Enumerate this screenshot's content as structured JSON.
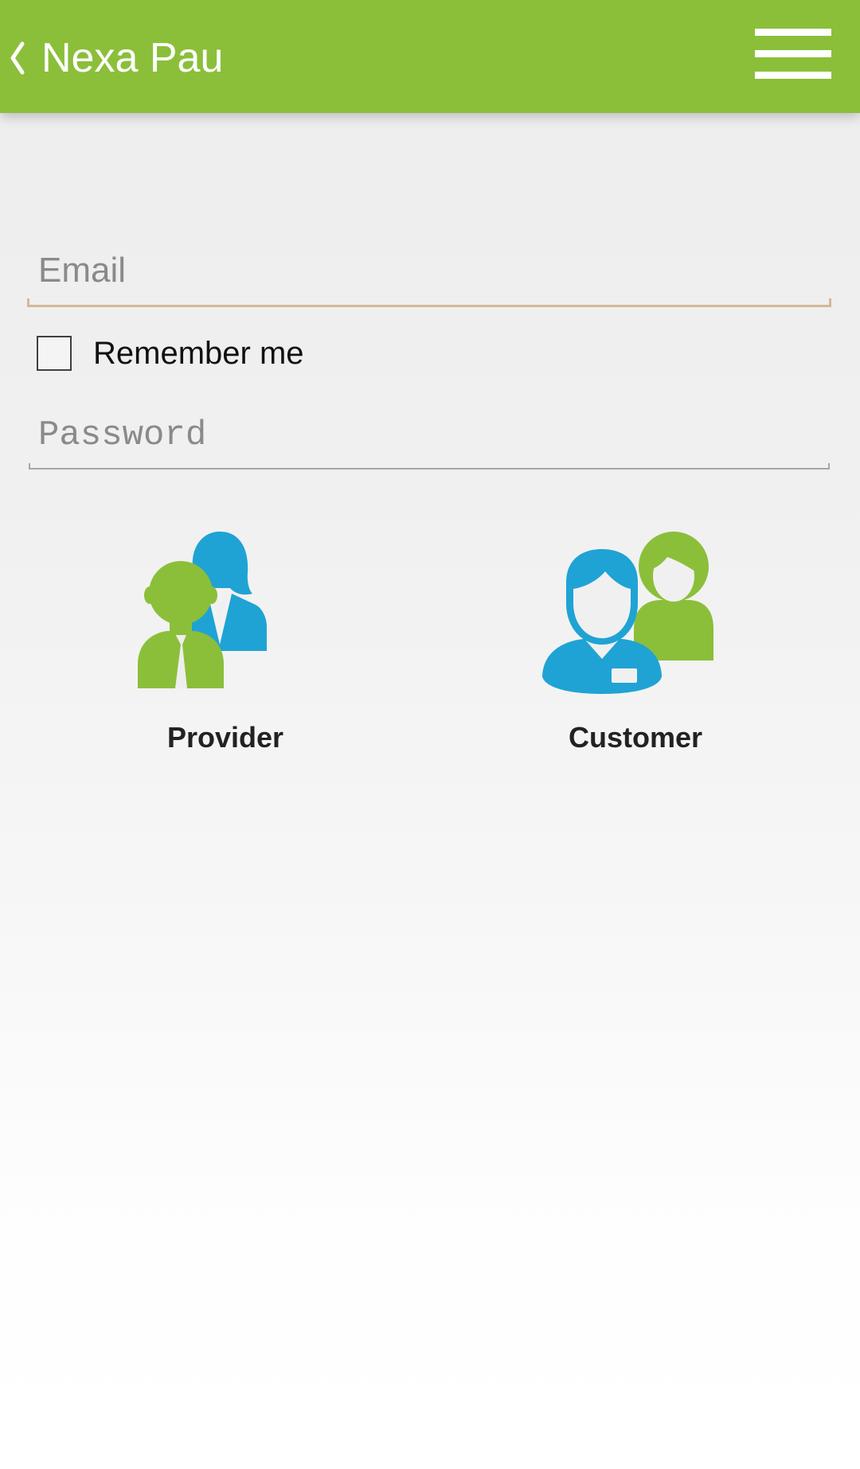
{
  "app_bar": {
    "title": "Nexa Pau",
    "back_icon": "chevron-left-icon",
    "menu_icon": "hamburger-menu-icon",
    "background_color": "#8bbf3a"
  },
  "login_form": {
    "email": {
      "placeholder": "Email",
      "value": ""
    },
    "remember_me": {
      "label": "Remember me",
      "checked": false
    },
    "password": {
      "placeholder": "Password",
      "value": ""
    }
  },
  "roles": {
    "provider": {
      "label": "Provider",
      "icon": "provider-people-icon"
    },
    "customer": {
      "label": "Customer",
      "icon": "customer-people-icon"
    }
  },
  "colors": {
    "green": "#8bbf3a",
    "blue": "#1fa3d4",
    "email_underline": "#d3b898"
  }
}
